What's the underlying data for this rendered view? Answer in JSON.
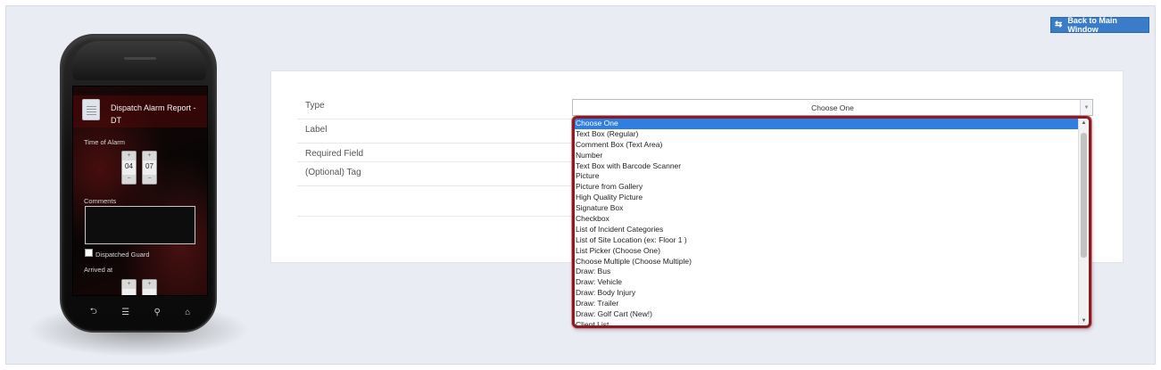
{
  "header": {
    "back_button_label": "Back to Main Window"
  },
  "phone_preview": {
    "form_title": "Dispatch Alarm Report - DT",
    "time_of_alarm_label": "Time of Alarm",
    "hour": "04",
    "minute": "07",
    "plus": "+",
    "minus": "−",
    "comments_label": "Comments",
    "dispatched_guard_label": "Dispatched Guard",
    "arrived_at_label": "Arrived at",
    "nav_icons": [
      "back-icon",
      "menu-icon",
      "search-icon",
      "home-icon"
    ]
  },
  "field_editor": {
    "rows": [
      {
        "label": "Type"
      },
      {
        "label": "Label"
      },
      {
        "label": "Required Field"
      },
      {
        "label": "(Optional) Tag"
      }
    ],
    "type_select": {
      "value": "Choose One"
    }
  },
  "type_dropdown": {
    "selected": "Choose One",
    "options": [
      "Choose One",
      "Text Box (Regular)",
      "Comment Box (Text Area)",
      "Number",
      "Text Box with Barcode Scanner",
      "Picture",
      "Picture from Gallery",
      "High Quality Picture",
      "Signature Box",
      "Checkbox",
      "List of Incident Categories",
      "List of Site Location (ex: Floor 1 )",
      "List Picker (Choose One)",
      "Choose Multiple (Choose Multiple)",
      "Draw: Bus",
      "Draw: Vehicle",
      "Draw: Body Injury",
      "Draw: Trailer",
      "Draw: Golf Cart (New!)",
      "Client List"
    ]
  },
  "colors": {
    "highlight_border": "#8b1a22",
    "selected_option": "#2f7fe0",
    "back_button": "#3b7cc9"
  }
}
